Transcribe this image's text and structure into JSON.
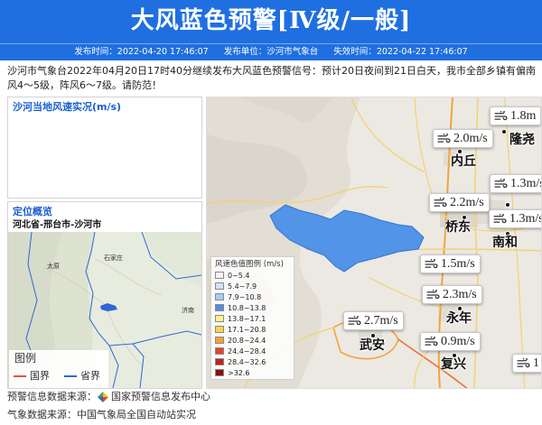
{
  "header": {
    "title": "大风蓝色预警[Ⅳ级/一般]",
    "publish_time_label": "发布时间：",
    "publish_time": "2022-04-20 17:46:07",
    "publisher_label": "发布单位：",
    "publisher": "沙河市气象台",
    "expire_label": "失效时间：",
    "expire_time": "2022-04-22 17:46:07"
  },
  "description": "沙河市气象台2022年04月20日17时40分继续发布大风蓝色预警信号：预计20日夜间到21日白天，我市全部乡镇有偏南风4～5级，阵风6～7级。请防范！",
  "wind_panel": {
    "title": "沙河当地风速实况(m/s)"
  },
  "location": {
    "title": "定位概览",
    "path": "河北省-邢台市-沙河市",
    "cities": [
      "石家庄",
      "太原",
      "济南"
    ],
    "legend": {
      "title": "图例",
      "items": [
        {
          "label": "国界",
          "color": "#d9534f"
        },
        {
          "label": "省界",
          "color": "#2f66d6"
        }
      ]
    }
  },
  "map": {
    "wind_labels": [
      "1.8m",
      "2.0m/s",
      "1.3m/s",
      "2.2m/s",
      "1.3m/s",
      "1.5m/s",
      "2.3m/s",
      "2.7m/s",
      "0.9m/s",
      "1"
    ],
    "cities": [
      "隆尧",
      "内丘",
      "桥东",
      "南和",
      "永年",
      "武安",
      "复兴"
    ],
    "warning_area_color": "#4a8fe7",
    "legend": {
      "title": "风速色值图例 (m/s)",
      "items": [
        {
          "label": "0~5.4",
          "color": "#f2f2f2"
        },
        {
          "label": "5.4~7.9",
          "color": "#cfe3f7"
        },
        {
          "label": "7.9~10.8",
          "color": "#a5cdf2"
        },
        {
          "label": "10.8~13.8",
          "color": "#4d8fe3"
        },
        {
          "label": "13.8~17.1",
          "color": "#fff38a"
        },
        {
          "label": "17.1~20.8",
          "color": "#fbd34b"
        },
        {
          "label": "20.8~24.4",
          "color": "#f8a332"
        },
        {
          "label": "24.4~28.4",
          "color": "#e4432a"
        },
        {
          "label": "28.4~32.6",
          "color": "#b8251c"
        },
        {
          "label": ">32.6",
          "color": "#8a1010"
        }
      ]
    }
  },
  "footer": {
    "warning_source_label": "预警信息数据来源：",
    "warning_source": "国家预警信息发布中心",
    "weather_source_label": "气象数据来源：",
    "weather_source": "中国气象局全国自动站实况"
  },
  "colors": {
    "brand_blue": "#1f6fe0",
    "panel_title": "#1a5fd0"
  }
}
